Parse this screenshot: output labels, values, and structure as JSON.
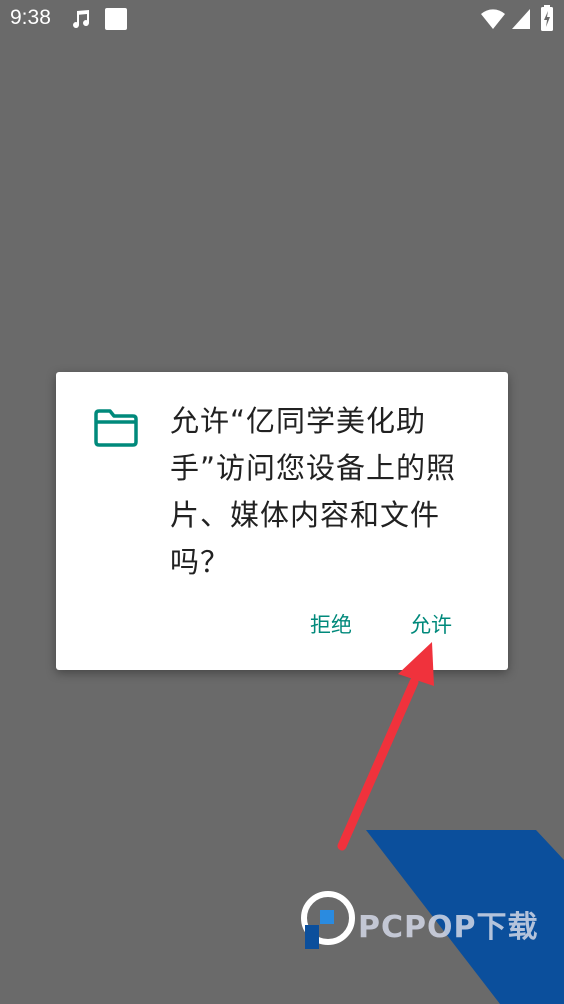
{
  "status_bar": {
    "time": "9:38",
    "icons": [
      "music-note-icon",
      "notification-square-icon",
      "wifi-icon",
      "signal-icon",
      "battery-icon"
    ]
  },
  "dialog": {
    "icon": "folder-icon",
    "message": "允许“亿同学美化助手”访问您设备上的照片、媒体内容和文件吗？",
    "deny_label": "拒绝",
    "allow_label": "允许"
  },
  "watermark": {
    "text": "PCPOP下载",
    "logo": "pcpop-logo"
  },
  "colors": {
    "scrim": "#6a6a6a",
    "accent": "#00897b",
    "arrow": "#f0323c",
    "watermark_blue": "#0b4f9c"
  }
}
